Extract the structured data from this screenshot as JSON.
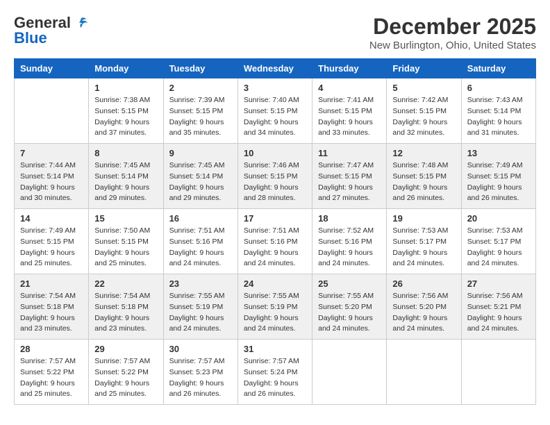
{
  "header": {
    "logo_general": "General",
    "logo_blue": "Blue",
    "month_title": "December 2025",
    "location": "New Burlington, Ohio, United States"
  },
  "weekdays": [
    "Sunday",
    "Monday",
    "Tuesday",
    "Wednesday",
    "Thursday",
    "Friday",
    "Saturday"
  ],
  "weeks": [
    [
      {
        "day": "",
        "info": ""
      },
      {
        "day": "1",
        "info": "Sunrise: 7:38 AM\nSunset: 5:15 PM\nDaylight: 9 hours\nand 37 minutes."
      },
      {
        "day": "2",
        "info": "Sunrise: 7:39 AM\nSunset: 5:15 PM\nDaylight: 9 hours\nand 35 minutes."
      },
      {
        "day": "3",
        "info": "Sunrise: 7:40 AM\nSunset: 5:15 PM\nDaylight: 9 hours\nand 34 minutes."
      },
      {
        "day": "4",
        "info": "Sunrise: 7:41 AM\nSunset: 5:15 PM\nDaylight: 9 hours\nand 33 minutes."
      },
      {
        "day": "5",
        "info": "Sunrise: 7:42 AM\nSunset: 5:15 PM\nDaylight: 9 hours\nand 32 minutes."
      },
      {
        "day": "6",
        "info": "Sunrise: 7:43 AM\nSunset: 5:14 PM\nDaylight: 9 hours\nand 31 minutes."
      }
    ],
    [
      {
        "day": "7",
        "info": "Sunrise: 7:44 AM\nSunset: 5:14 PM\nDaylight: 9 hours\nand 30 minutes."
      },
      {
        "day": "8",
        "info": "Sunrise: 7:45 AM\nSunset: 5:14 PM\nDaylight: 9 hours\nand 29 minutes."
      },
      {
        "day": "9",
        "info": "Sunrise: 7:45 AM\nSunset: 5:14 PM\nDaylight: 9 hours\nand 29 minutes."
      },
      {
        "day": "10",
        "info": "Sunrise: 7:46 AM\nSunset: 5:15 PM\nDaylight: 9 hours\nand 28 minutes."
      },
      {
        "day": "11",
        "info": "Sunrise: 7:47 AM\nSunset: 5:15 PM\nDaylight: 9 hours\nand 27 minutes."
      },
      {
        "day": "12",
        "info": "Sunrise: 7:48 AM\nSunset: 5:15 PM\nDaylight: 9 hours\nand 26 minutes."
      },
      {
        "day": "13",
        "info": "Sunrise: 7:49 AM\nSunset: 5:15 PM\nDaylight: 9 hours\nand 26 minutes."
      }
    ],
    [
      {
        "day": "14",
        "info": "Sunrise: 7:49 AM\nSunset: 5:15 PM\nDaylight: 9 hours\nand 25 minutes."
      },
      {
        "day": "15",
        "info": "Sunrise: 7:50 AM\nSunset: 5:15 PM\nDaylight: 9 hours\nand 25 minutes."
      },
      {
        "day": "16",
        "info": "Sunrise: 7:51 AM\nSunset: 5:16 PM\nDaylight: 9 hours\nand 24 minutes."
      },
      {
        "day": "17",
        "info": "Sunrise: 7:51 AM\nSunset: 5:16 PM\nDaylight: 9 hours\nand 24 minutes."
      },
      {
        "day": "18",
        "info": "Sunrise: 7:52 AM\nSunset: 5:16 PM\nDaylight: 9 hours\nand 24 minutes."
      },
      {
        "day": "19",
        "info": "Sunrise: 7:53 AM\nSunset: 5:17 PM\nDaylight: 9 hours\nand 24 minutes."
      },
      {
        "day": "20",
        "info": "Sunrise: 7:53 AM\nSunset: 5:17 PM\nDaylight: 9 hours\nand 24 minutes."
      }
    ],
    [
      {
        "day": "21",
        "info": "Sunrise: 7:54 AM\nSunset: 5:18 PM\nDaylight: 9 hours\nand 23 minutes."
      },
      {
        "day": "22",
        "info": "Sunrise: 7:54 AM\nSunset: 5:18 PM\nDaylight: 9 hours\nand 23 minutes."
      },
      {
        "day": "23",
        "info": "Sunrise: 7:55 AM\nSunset: 5:19 PM\nDaylight: 9 hours\nand 24 minutes."
      },
      {
        "day": "24",
        "info": "Sunrise: 7:55 AM\nSunset: 5:19 PM\nDaylight: 9 hours\nand 24 minutes."
      },
      {
        "day": "25",
        "info": "Sunrise: 7:55 AM\nSunset: 5:20 PM\nDaylight: 9 hours\nand 24 minutes."
      },
      {
        "day": "26",
        "info": "Sunrise: 7:56 AM\nSunset: 5:20 PM\nDaylight: 9 hours\nand 24 minutes."
      },
      {
        "day": "27",
        "info": "Sunrise: 7:56 AM\nSunset: 5:21 PM\nDaylight: 9 hours\nand 24 minutes."
      }
    ],
    [
      {
        "day": "28",
        "info": "Sunrise: 7:57 AM\nSunset: 5:22 PM\nDaylight: 9 hours\nand 25 minutes."
      },
      {
        "day": "29",
        "info": "Sunrise: 7:57 AM\nSunset: 5:22 PM\nDaylight: 9 hours\nand 25 minutes."
      },
      {
        "day": "30",
        "info": "Sunrise: 7:57 AM\nSunset: 5:23 PM\nDaylight: 9 hours\nand 26 minutes."
      },
      {
        "day": "31",
        "info": "Sunrise: 7:57 AM\nSunset: 5:24 PM\nDaylight: 9 hours\nand 26 minutes."
      },
      {
        "day": "",
        "info": ""
      },
      {
        "day": "",
        "info": ""
      },
      {
        "day": "",
        "info": ""
      }
    ]
  ]
}
